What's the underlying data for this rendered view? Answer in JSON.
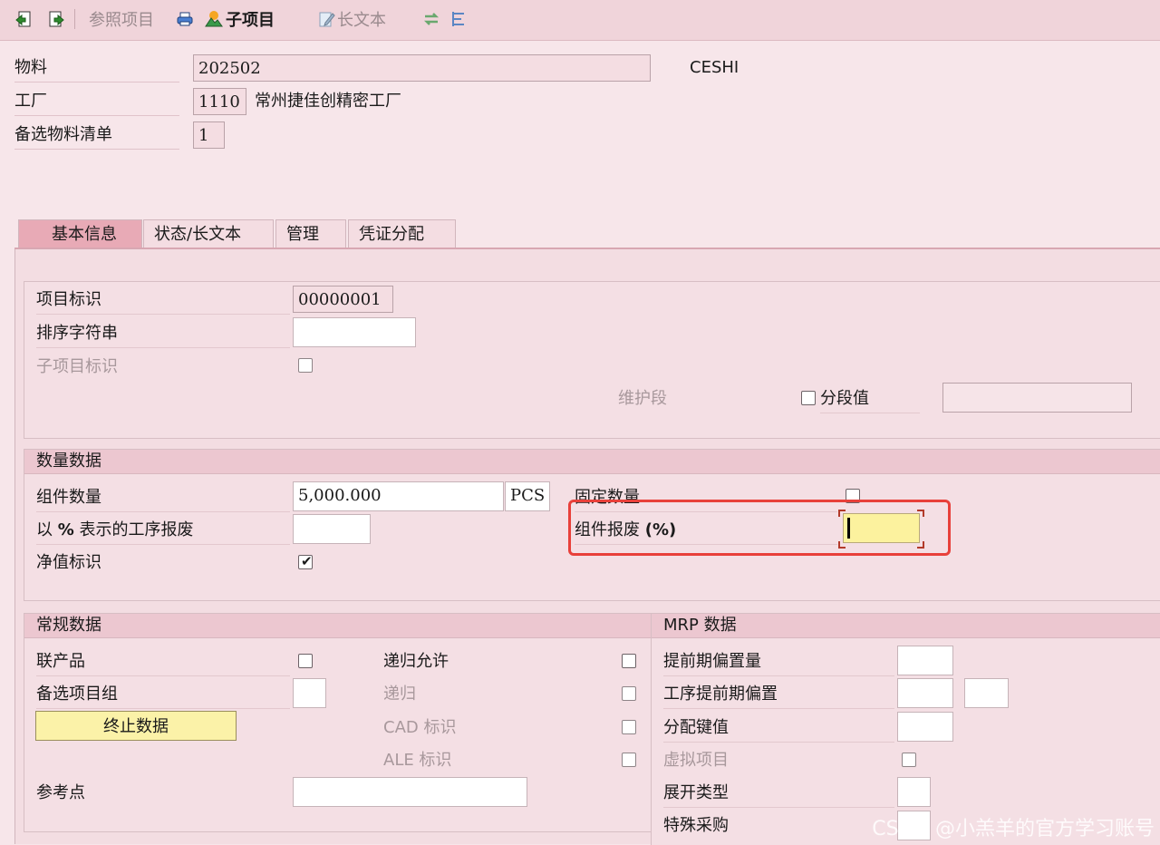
{
  "toolbar": {
    "reference_item": "参照项目",
    "sub_item": "子项目",
    "long_text": "长文本"
  },
  "header": {
    "material_label": "物料",
    "material_value": "202502",
    "material_desc": "CESHI",
    "plant_label": "工厂",
    "plant_value": "1110",
    "plant_desc": "常州捷佳创精密工厂",
    "alt_bom_label": "备选物料清单",
    "alt_bom_value": "1"
  },
  "tabs": [
    "基本信息",
    "状态/长文本",
    "管理",
    "凭证分配"
  ],
  "item_section": {
    "item_id_label": "项目标识",
    "item_id_value": "00000001",
    "sort_string_label": "排序字符串",
    "sort_string_value": "",
    "sub_item_label": "子项目标识",
    "sub_item_checked": false,
    "maint_segment_label": "维护段",
    "segment_value_label": "分段值",
    "segment_value_checked": false,
    "segment_value": ""
  },
  "quantity": {
    "title": "数量数据",
    "component_qty_label": "组件数量",
    "component_qty_value": "5,000.000",
    "unit": "PCS",
    "fixed_qty_label": "固定数量",
    "fixed_qty_checked": false,
    "op_scrap_label_a": "以 ",
    "op_scrap_label_b": "%",
    "op_scrap_label_c": " 表示的工序报废",
    "op_scrap_value": "",
    "component_scrap_label_a": "组件报废 ",
    "component_scrap_label_b": "(%)",
    "component_scrap_value": "",
    "net_id_label": "净值标识",
    "net_id_checked": true
  },
  "general": {
    "title": "常规数据",
    "co_product_label": "联产品",
    "co_product_checked": false,
    "alt_group_label": "备选项目组",
    "alt_group_value": "",
    "stop_data_button": "终止数据",
    "reference_point_label": "参考点",
    "reference_point_value": "",
    "recursive_allowed_label": "递归允许",
    "recursive_allowed_checked": false,
    "recursive_label": "递归",
    "recursive_checked": false,
    "cad_label": "CAD 标识",
    "cad_checked": false,
    "ale_label": "ALE 标识",
    "ale_checked": false
  },
  "mrp": {
    "title": "MRP 数据",
    "lead_offset_label": "提前期偏置量",
    "lead_offset_value": "",
    "op_lead_offset_label": "工序提前期偏置",
    "op_lead_offset_value1": "",
    "op_lead_offset_value2": "",
    "dist_key_label": "分配键值",
    "dist_key_value": "",
    "phantom_label": "虚拟项目",
    "phantom_checked": false,
    "explosion_type_label": "展开类型",
    "explosion_type_value": "",
    "special_proc_label": "特殊采购",
    "special_proc_value": ""
  },
  "watermark": "CSDN @小羔羊的官方学习账号"
}
